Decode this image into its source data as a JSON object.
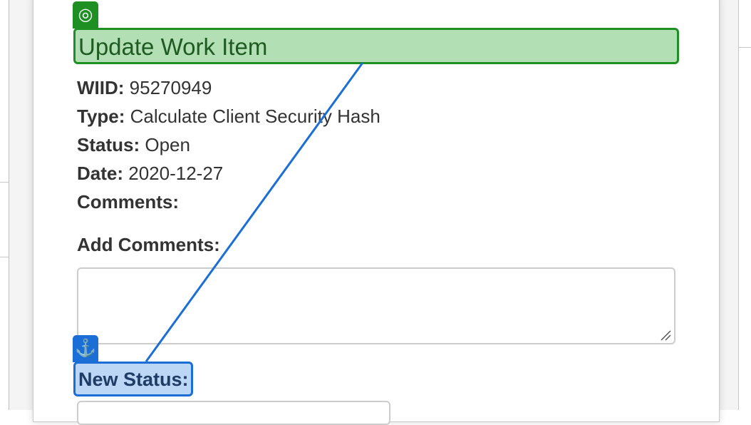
{
  "modal": {
    "title": "Update Work Item",
    "fields": [
      {
        "label": "WIID:",
        "value": "95270949"
      },
      {
        "label": "Type:",
        "value": "Calculate Client Security Hash"
      },
      {
        "label": "Status:",
        "value": "Open"
      },
      {
        "label": "Date:",
        "value": "2020-12-27"
      },
      {
        "label": "Comments:",
        "value": ""
      }
    ],
    "add_comments_label": "Add Comments:",
    "add_comments_value": "",
    "new_status_label": "New Status:"
  },
  "annotations": {
    "target_icon": "target-icon",
    "anchor_icon": "anchor-icon",
    "target_color": "#1e8f23",
    "anchor_color": "#1b6ed6"
  }
}
